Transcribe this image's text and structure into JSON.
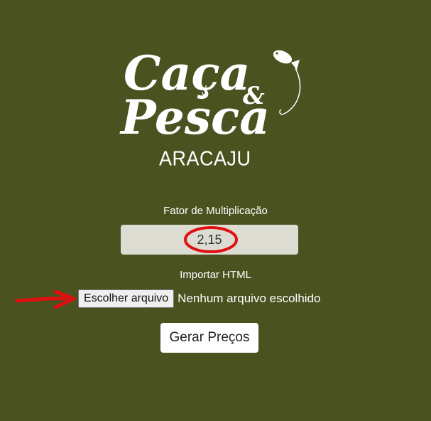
{
  "logo": {
    "line1": "Caça",
    "ampersand": "&",
    "line2": "Pesca",
    "city": "ARACAJU"
  },
  "factor": {
    "label": "Fator de Multiplicação",
    "value": "2,15"
  },
  "import": {
    "label": "Importar HTML",
    "button_label": "Escolher arquivo",
    "status": "Nenhum arquivo escolhido"
  },
  "generate": {
    "label": "Gerar Preços"
  },
  "annotations": {
    "highlight_color": "#e01010",
    "circle_icon": "red-circle-annotation",
    "arrow_icon": "red-arrow-annotation"
  },
  "colors": {
    "background": "#4a5220",
    "input_background": "#dcdcd2"
  }
}
